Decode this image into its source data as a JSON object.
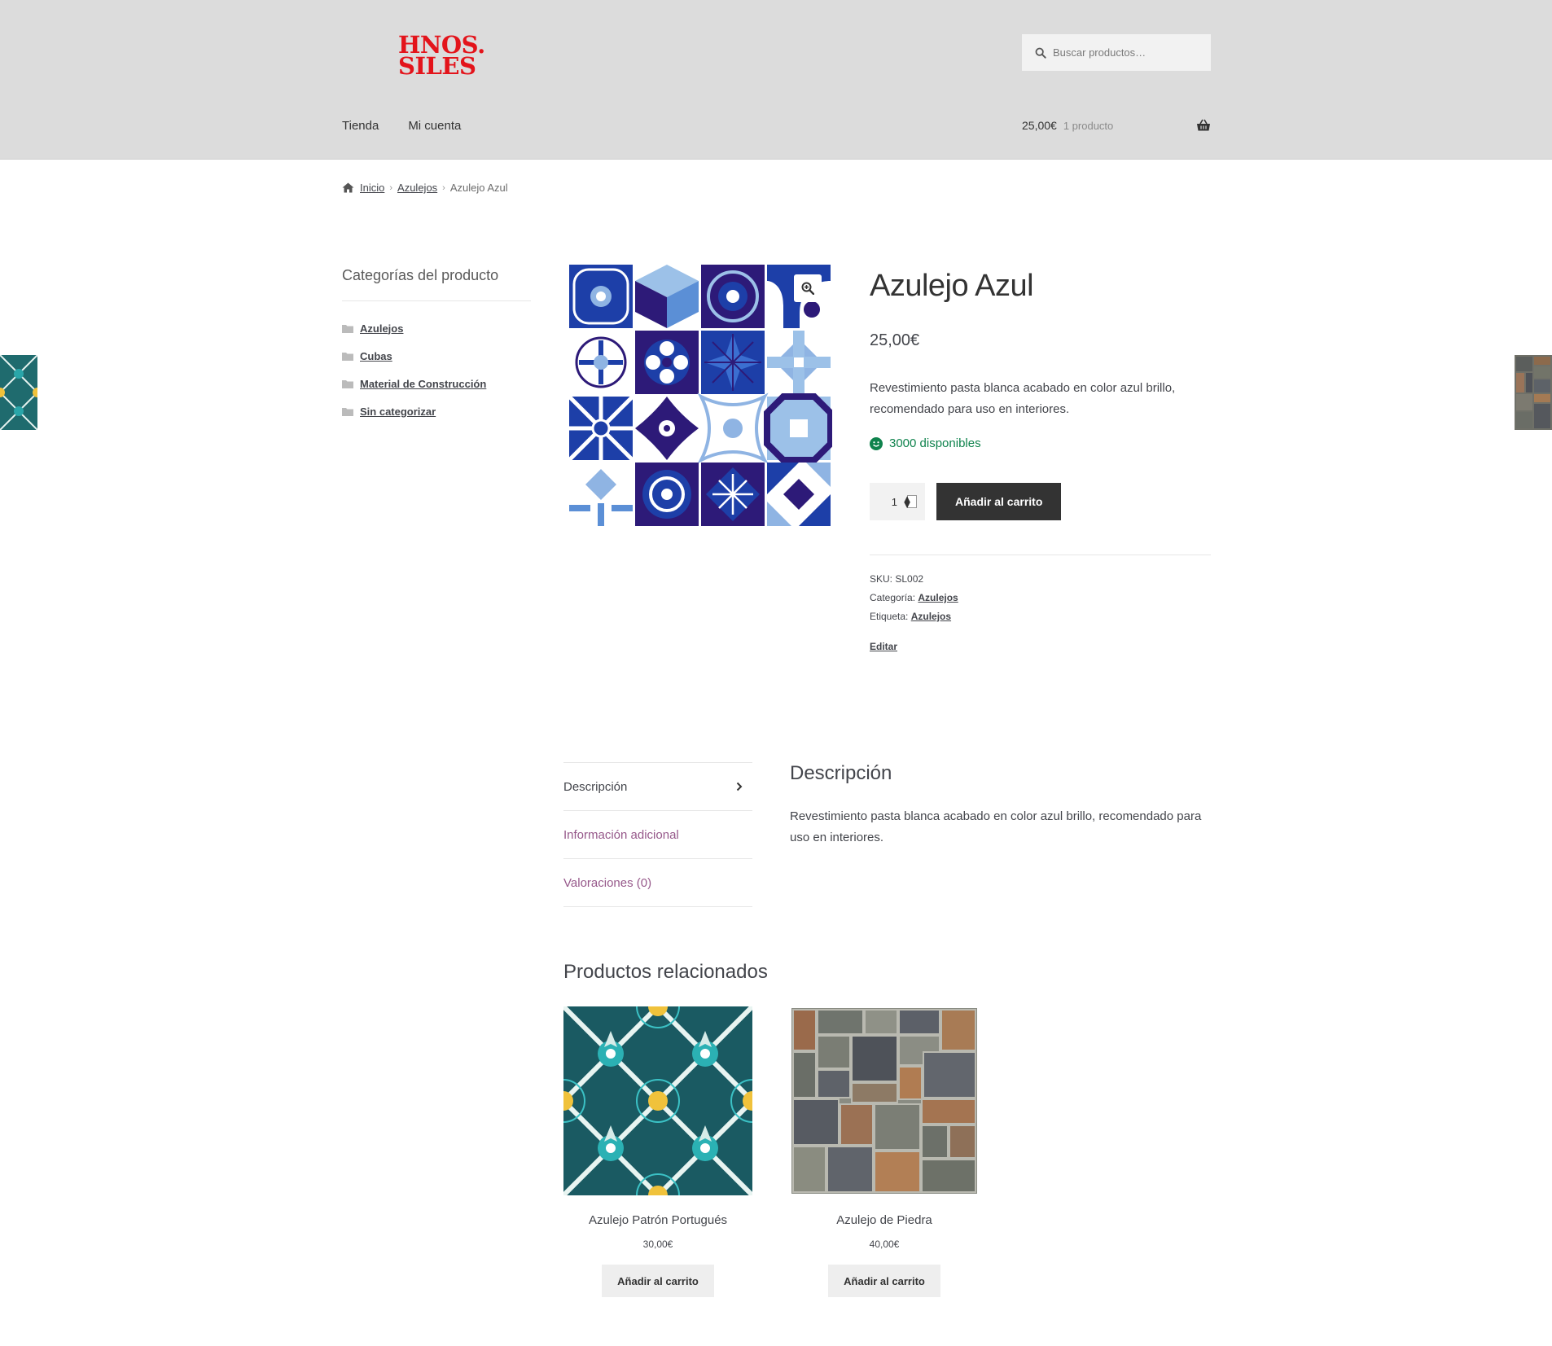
{
  "header": {
    "logo_line1": "HNOS.",
    "logo_line2": "SILES",
    "search_placeholder": "Buscar productos…",
    "nav": [
      "Tienda",
      "Mi cuenta"
    ],
    "cart_amount": "25,00€",
    "cart_count": "1 producto"
  },
  "breadcrumb": {
    "home": "Inicio",
    "category": "Azulejos",
    "current": "Azulejo Azul"
  },
  "sidebar": {
    "title": "Categorías del producto",
    "categories": [
      "Azulejos",
      "Cubas",
      "Material de Construcción",
      "Sin categorizar"
    ]
  },
  "product": {
    "title": "Azulejo Azul",
    "price": "25,00€",
    "short_description": "Revestimiento pasta blanca acabado en color azul brillo, recomendado para uso en interiores.",
    "stock": "3000 disponibles",
    "quantity": "1",
    "add_to_cart": "Añadir al carrito",
    "sku_label": "SKU:",
    "sku": "SL002",
    "category_label": "Categoría:",
    "category": "Azulejos",
    "tag_label": "Etiqueta:",
    "tag": "Azulejos",
    "edit": "Editar"
  },
  "tabs": {
    "items": [
      "Descripción",
      "Información adicional",
      "Valoraciones (0)"
    ],
    "panel_title": "Descripción",
    "panel_text": "Revestimiento pasta blanca acabado en color azul brillo, recomendado para uso en interiores."
  },
  "related": {
    "title": "Productos relacionados",
    "items": [
      {
        "name": "Azulejo Patrón Portugués",
        "price": "30,00€",
        "button": "Añadir al carrito"
      },
      {
        "name": "Azulejo de Piedra",
        "price": "40,00€",
        "button": "Añadir al carrito"
      }
    ]
  },
  "colors": {
    "header_bg": "#dcdcdc",
    "logo_red": "#e3141b",
    "button_dark": "#333333",
    "link_purple": "#96588a",
    "stock_green": "#0f834d"
  }
}
